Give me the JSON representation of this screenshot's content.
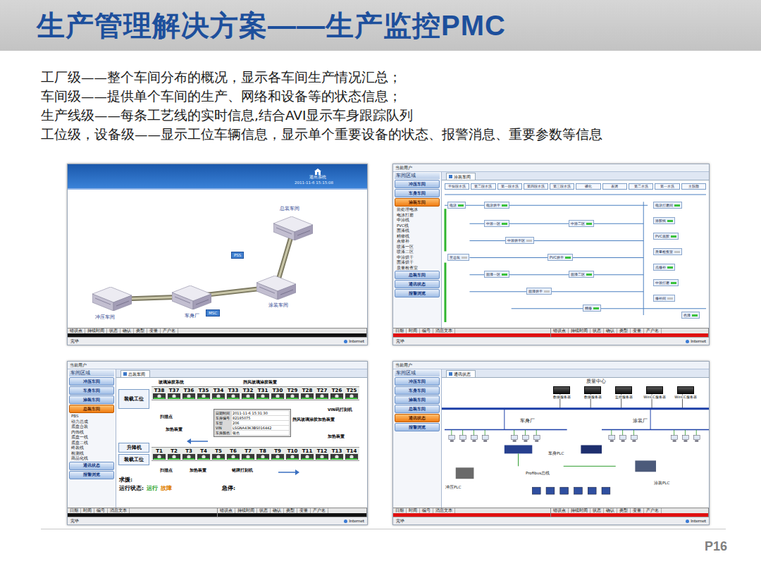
{
  "header": {
    "title": "生产管理解决方案——生产监控PMC"
  },
  "intro": [
    "工厂级——整个车间分布的概况，显示各车间生产情况汇总；",
    "车间级——提供单个车间的生产、网络和设备等的状态信息；",
    "生产线级——每条工艺线的实时信息,结合AVI显示车身跟踪队列",
    "工位级，设备级——显示工位车辆信息，显示单个重要设备的状态、报警消息、重要参数等信息"
  ],
  "factory_view": {
    "exit_label": "退出系统",
    "time": "2011-11-6 15:15:08",
    "buildings": [
      {
        "name": "总装车间"
      },
      {
        "name": "冲压车间"
      },
      {
        "name": "车身厂"
      },
      {
        "name": "涂装车间"
      }
    ],
    "tags": [
      "PSS",
      "MSC"
    ],
    "alarm_columns": [
      "错误点",
      "持续时间",
      "状态",
      "确认",
      "类型",
      "变量",
      "产户名"
    ],
    "alarm_rows": [
      {
        "color": "#111111"
      }
    ],
    "status_left": "完毕",
    "status_right": "Internet"
  },
  "workshop_view": {
    "user_label": "当前用户",
    "area_title": "车间区域",
    "tab": "涂装车间",
    "sidebar": [
      {
        "label": "冲压车间",
        "kind": "nav",
        "selected": false
      },
      {
        "label": "车身车间",
        "kind": "nav",
        "selected": false
      },
      {
        "label": "涂装车间",
        "kind": "nav",
        "selected": true
      },
      {
        "label": "前处理电泳",
        "kind": "sub",
        "selected": false
      },
      {
        "label": "电泳打磨",
        "kind": "sub",
        "selected": false
      },
      {
        "label": "中涂线",
        "kind": "sub",
        "selected": false
      },
      {
        "label": "PVC线",
        "kind": "sub",
        "selected": false
      },
      {
        "label": "面漆线",
        "kind": "sub",
        "selected": false
      },
      {
        "label": "精修线",
        "kind": "sub",
        "selected": false
      },
      {
        "label": "点修补",
        "kind": "sub",
        "selected": false
      },
      {
        "label": "喷漆一区",
        "kind": "sub",
        "selected": false
      },
      {
        "label": "喷漆二区",
        "kind": "sub",
        "selected": false
      },
      {
        "label": "中涂烘干",
        "kind": "sub",
        "selected": false
      },
      {
        "label": "面漆烘干",
        "kind": "sub",
        "selected": false
      },
      {
        "label": "质量检查室",
        "kind": "sub",
        "selected": false
      },
      {
        "label": "总装车间",
        "kind": "nav",
        "selected": false
      },
      {
        "label": "通讯状态",
        "kind": "nav",
        "selected": false
      },
      {
        "label": "报警浏览",
        "kind": "nav",
        "selected": false
      }
    ],
    "process_row": [
      "干燥段水洗",
      "第二段水洗",
      "第一段水洗",
      "第四段水洗",
      "第三段水洗",
      "磷化",
      "表调",
      "第二水洗",
      "第一水洗",
      "主脱脂"
    ],
    "nodes": [
      {
        "label": "电泳",
        "running": true
      },
      {
        "label": "电泳烘干",
        "running": true
      },
      {
        "label": "电泳打磨间",
        "running": true
      },
      {
        "label": "中涂一区",
        "running": true
      },
      {
        "label": "中涂二区",
        "running": true
      },
      {
        "label": "中涂烘干区",
        "running": false
      },
      {
        "label": "PVC烘干",
        "running": true
      },
      {
        "label": "面漆一区",
        "running": true
      },
      {
        "label": "面漆二区",
        "running": true
      },
      {
        "label": "面漆烘干",
        "running": false
      },
      {
        "label": "精修",
        "running": true
      },
      {
        "label": "至总装",
        "running": false
      },
      {
        "label": "涂胶线",
        "running": true
      },
      {
        "label": "PVC底胶",
        "running": true
      },
      {
        "label": "质量检查室",
        "running": false
      },
      {
        "label": "点修补",
        "running": true
      },
      {
        "label": "中涂打磨",
        "running": true
      },
      {
        "label": "修补间",
        "running": false
      },
      {
        "label": "色漆",
        "running": true
      }
    ],
    "alarm_columns_left": [
      "日期",
      "时间",
      "编号",
      "消息文本"
    ],
    "alarm_columns_right": [
      "错误点",
      "持续时间",
      "状态",
      "确认",
      "类型",
      "变量",
      "产户名"
    ],
    "alarm_rows": [
      {
        "color": "#e01010"
      }
    ],
    "status_left": "完毕",
    "status_right": "Internet"
  },
  "line_view": {
    "user_label": "当前用户",
    "area_title": "车间区域",
    "tab": "总装车间",
    "sidebar": [
      {
        "label": "冲压车间",
        "kind": "nav",
        "selected": false
      },
      {
        "label": "车身车间",
        "kind": "nav",
        "selected": false
      },
      {
        "label": "涂装车间",
        "kind": "nav",
        "selected": false
      },
      {
        "label": "总装车间",
        "kind": "nav",
        "selected": true
      },
      {
        "label": "PBS",
        "kind": "sub",
        "selected": false
      },
      {
        "label": "动力总成",
        "kind": "sub",
        "selected": false
      },
      {
        "label": "底盘合装",
        "kind": "sub",
        "selected": false
      },
      {
        "label": "内饰线",
        "kind": "sub",
        "selected": false
      },
      {
        "label": "底盘一线",
        "kind": "sub",
        "selected": false
      },
      {
        "label": "底盘二线",
        "kind": "sub",
        "selected": false
      },
      {
        "label": "终装线",
        "kind": "sub",
        "selected": false
      },
      {
        "label": "检测线",
        "kind": "sub",
        "selected": false
      },
      {
        "label": "商品化线",
        "kind": "sub",
        "selected": false
      },
      {
        "label": "通讯状态",
        "kind": "nav",
        "selected": false
      },
      {
        "label": "报警浏览",
        "kind": "nav",
        "selected": false
      }
    ],
    "system_titles": [
      "玻璃涂胶系统",
      "挡风玻璃涂胶装置"
    ],
    "upper_stations": [
      "T38",
      "T37",
      "T36",
      "T35",
      "T34",
      "T33",
      "T32",
      "T31",
      "T30",
      "T29",
      "T28",
      "T27",
      "T26",
      "T25"
    ],
    "lower_stations": [
      "T1",
      "T2",
      "T3",
      "T4",
      "T5",
      "T6",
      "T7",
      "T8",
      "T9",
      "T10",
      "T11",
      "T12",
      "T13",
      "T14"
    ],
    "side_boxes": [
      "装载工位",
      "升降机",
      "装载工位"
    ],
    "labels": [
      "扫描点",
      "加热装置",
      "挡风玻璃涂胶加热装置",
      "VIN码打刻机",
      "加热装置",
      "扫描点",
      "加热装置",
      "铭牌打刻机"
    ],
    "popup": [
      {
        "label": "日期时间",
        "value": "2011-11-6 15:31:30"
      },
      {
        "label": "车身编号",
        "value": "82185075"
      },
      {
        "label": "车型",
        "value": "206"
      },
      {
        "label": "VIN",
        "value": "LSGNA43K3BS016442"
      },
      {
        "label": "车身颜色",
        "value": "银色"
      }
    ],
    "help_label": "求援:",
    "state_label": "运行状态:",
    "states": [
      {
        "label": "运行",
        "color": "#1aa01a"
      },
      {
        "label": "故障",
        "color": "#e08000"
      }
    ],
    "estop_label": "急停:",
    "alarm_columns_left": [
      "日期",
      "时间",
      "编号",
      "消息文本"
    ],
    "alarm_columns_right": [
      "错误点",
      "持续时间",
      "状态",
      "确认",
      "类型",
      "变量",
      "产户名"
    ],
    "alarm_rows": [
      {
        "color": "#111111"
      }
    ],
    "status_left": "完毕",
    "status_right": "Internet"
  },
  "network_view": {
    "user_label": "当前用户",
    "area_title": "车间区域",
    "tab": "通讯状态",
    "sidebar": [
      {
        "label": "冲压车间",
        "kind": "nav",
        "selected": false
      },
      {
        "label": "车身车间",
        "kind": "nav",
        "selected": false
      },
      {
        "label": "涂装车间",
        "kind": "nav",
        "selected": false
      },
      {
        "label": "总装车间",
        "kind": "nav",
        "selected": false
      },
      {
        "label": "通讯状态",
        "kind": "nav",
        "selected": true
      },
      {
        "label": "报警浏览",
        "kind": "nav",
        "selected": false
      }
    ],
    "center_title": "质量中心",
    "servers": [
      "数据服务器",
      "数据服务器",
      "监控服务器",
      "WinCC服务器",
      "WinCC服务器"
    ],
    "areas": [
      "车身厂",
      "涂装厂"
    ],
    "plc_labels": [
      "冲压PLC",
      "车身PLC",
      "Profibus总线",
      "涂装PLC"
    ],
    "alarm_columns_left": [
      "日期",
      "时间",
      "编号",
      "消息文本"
    ],
    "alarm_columns_right": [
      "错误点",
      "持续时间",
      "状态",
      "确认",
      "类型",
      "变量",
      "产户名"
    ],
    "alarm_rows": [
      {
        "color": "#e01010"
      }
    ],
    "status_left": "完毕",
    "status_right": "Internet"
  },
  "page_number": "P16"
}
